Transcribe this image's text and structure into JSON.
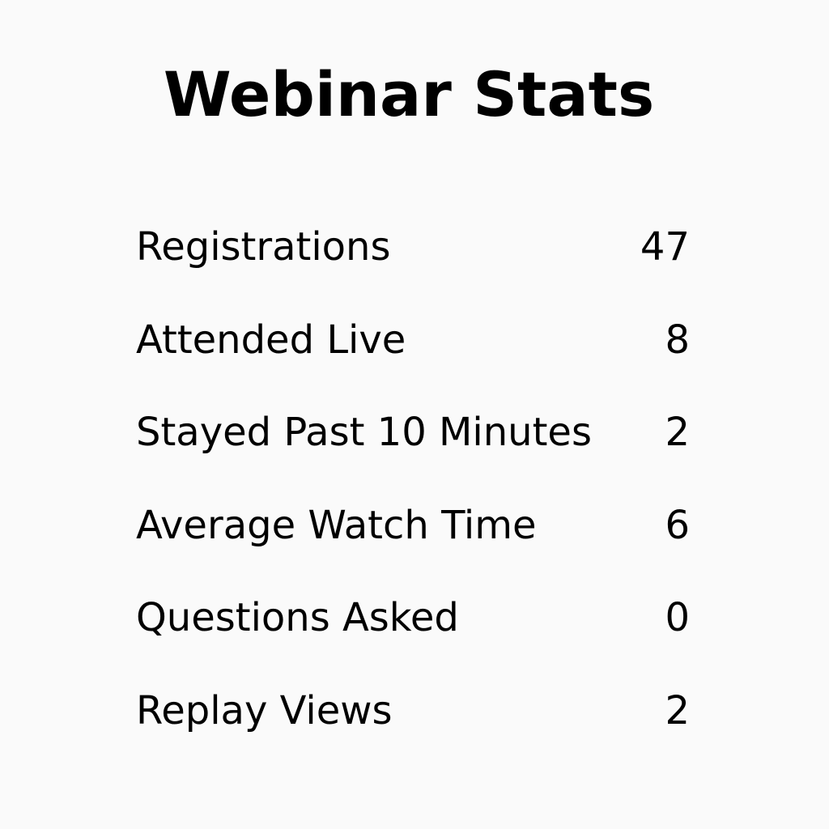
{
  "title": "Webinar Stats",
  "stats": [
    {
      "label": "Registrations",
      "value": "47"
    },
    {
      "label": "Attended Live",
      "value": "8"
    },
    {
      "label": "Stayed Past 10 Minutes",
      "value": "2"
    },
    {
      "label": "Average Watch Time",
      "value": "6"
    },
    {
      "label": "Questions Asked",
      "value": "0"
    },
    {
      "label": "Replay Views",
      "value": "2"
    }
  ]
}
